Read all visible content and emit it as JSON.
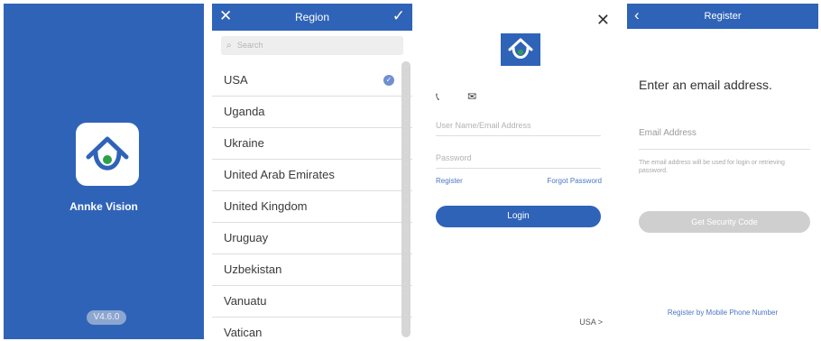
{
  "colors": {
    "brand_blue": "#2f63b8",
    "link_blue": "#4b76c4",
    "disabled_gray": "#cfcfcf",
    "divider": "#dedede",
    "icon_green": "#2ea04a"
  },
  "splash": {
    "app_icon": "house-logo-icon",
    "app_name": "Annke Vision",
    "version": "V4.6.0"
  },
  "region": {
    "close_icon": "close-icon",
    "title": "Region",
    "confirm_icon": "checkmark-icon",
    "search_placeholder": "Search",
    "search_icon": "search-icon",
    "selected": "USA",
    "countries": [
      {
        "name": "USA"
      },
      {
        "name": "Uganda"
      },
      {
        "name": "Ukraine"
      },
      {
        "name": "United Arab Emirates"
      },
      {
        "name": "United Kingdom"
      },
      {
        "name": "Uruguay"
      },
      {
        "name": "Uzbekistan"
      },
      {
        "name": "Vanuatu"
      },
      {
        "name": "Vatican"
      }
    ]
  },
  "login": {
    "close_icon": "close-icon",
    "logo_icon": "house-logo-icon",
    "phone_tab_icon": "phone-icon",
    "email_tab_icon": "envelope-icon",
    "username_placeholder": "User Name/Email Address",
    "password_placeholder": "Password",
    "register_link": "Register",
    "forgot_link": "Forgot Password",
    "login_button": "Login",
    "region_label": "USA",
    "region_chevron": ">"
  },
  "register": {
    "back_icon": "chevron-left-icon",
    "title": "Register",
    "heading": "Enter an email address.",
    "email_label": "Email Address",
    "hint": "The email address will be used for login or retrieving password.",
    "code_button": "Get Security Code",
    "mobile_link": "Register by Mobile Phone Number"
  }
}
